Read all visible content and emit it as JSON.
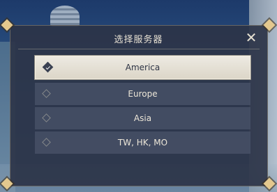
{
  "dialog": {
    "title": "选择服务器",
    "close_icon": "close-icon"
  },
  "servers": [
    {
      "label": "America",
      "selected": true,
      "icon": "selected-check-diamond-icon"
    },
    {
      "label": "Europe",
      "selected": false,
      "icon": "diamond-icon"
    },
    {
      "label": "Asia",
      "selected": false,
      "icon": "diamond-icon"
    },
    {
      "label": "TW, HK, MO",
      "selected": false,
      "icon": "diamond-icon"
    }
  ],
  "colors": {
    "panel": "#2c3448",
    "item": "#465066",
    "selected_item": "#ebe7dd",
    "accent_gold": "#e3c88e",
    "text_light": "#ece6d8",
    "text_dark": "#2e3444"
  }
}
